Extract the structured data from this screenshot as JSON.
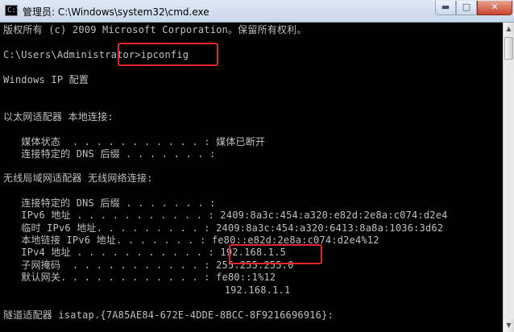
{
  "window": {
    "title": "管理员: C:\\Windows\\system32\\cmd.exe",
    "minimize_glyph": "▬",
    "maximize_glyph": "□",
    "close_glyph": "✕",
    "icon": "command-prompt-icon"
  },
  "console": {
    "lines": [
      "版权所有 (c) 2009 Microsoft Corporation。保留所有权利。",
      "C:\\Users\\Administrator>ipconfig",
      "Windows IP 配置",
      "以太网适配器 本地连接:",
      "   媒体状态  . . . . . . . . . . . : 媒体已断开",
      "   连接特定的 DNS 后缀 . . . . . . . :",
      "无线局域网适配器 无线网络连接:",
      "   连接特定的 DNS 后缀 . . . . . . . :",
      "   IPv6 地址 . . . . . . . . . . . : 2409:8a3c:454:a320:e82d:2e8a:c074:d2e4",
      "   临时 IPv6 地址. . . . . . . . . : 2409:8a3c:454:a320:6413:8a8a:1036:3d62",
      "   本地链接 IPv6 地址. . . . . . . : fe80::e82d:2e8a:c074:d2e4%12",
      "   IPv4 地址 . . . . . . . . . . . : 192.168.1.5",
      "   子网掩码  . . . . . . . . . . . : 255.255.255.0",
      "   默认网关. . . . . . . . . . . . : fe80::1%12",
      "                                     192.168.1.1",
      "隧道适配器 isatap.{7A85AE84-672E-4DDE-8BCC-8F9216696916}:"
    ]
  },
  "colors": {
    "console_bg": "#000000",
    "console_text": "#c0c0c0",
    "highlight": "#e3262a"
  }
}
